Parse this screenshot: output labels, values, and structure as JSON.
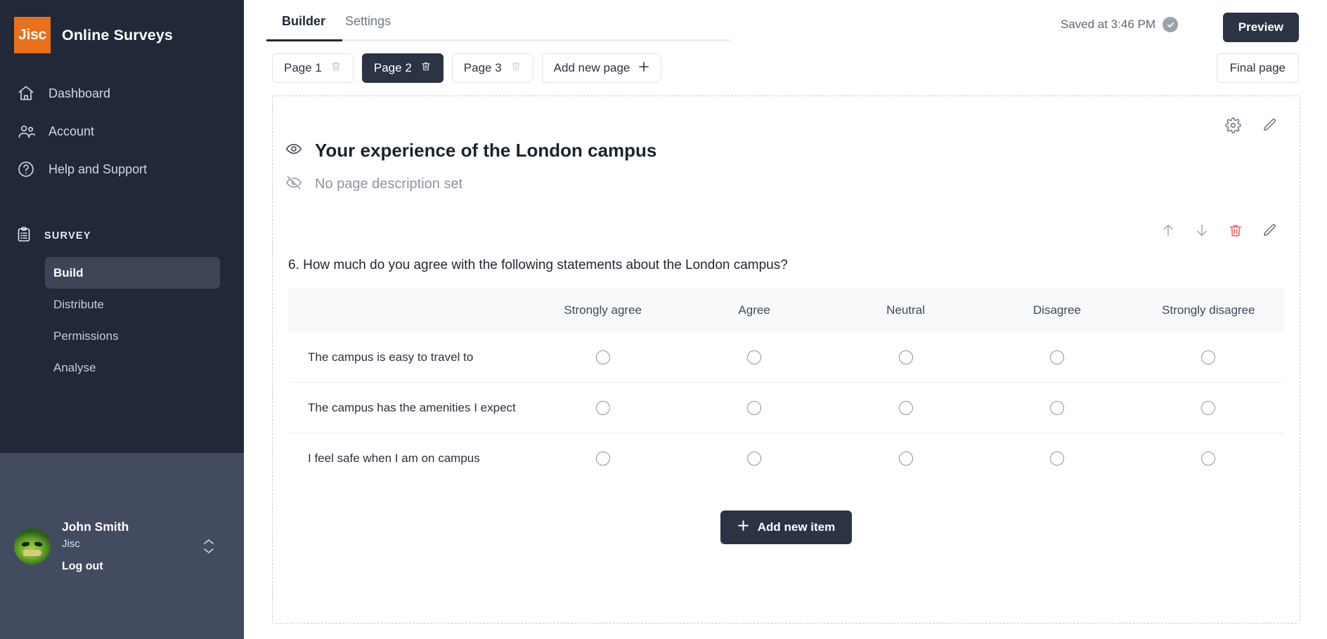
{
  "sidebar": {
    "brand": {
      "logo_text": "Jisc",
      "title": "Online Surveys"
    },
    "nav": [
      {
        "label": "Dashboard",
        "icon": "home-icon"
      },
      {
        "label": "Account",
        "icon": "users-icon"
      },
      {
        "label": "Help and Support",
        "icon": "question-circle-icon"
      }
    ],
    "survey_section": {
      "label": "SURVEY",
      "icon": "clipboard-icon"
    },
    "survey_items": [
      {
        "label": "Build",
        "active": true
      },
      {
        "label": "Distribute",
        "active": false
      },
      {
        "label": "Permissions",
        "active": false
      },
      {
        "label": "Analyse",
        "active": false
      }
    ],
    "user": {
      "name": "John Smith",
      "org": "Jisc",
      "logout_label": "Log out",
      "avatar_icon": "avatar"
    }
  },
  "topbar": {
    "tabs": [
      {
        "label": "Builder",
        "active": true
      },
      {
        "label": "Settings",
        "active": false
      }
    ],
    "saved_status": "Saved at 3:46 PM",
    "saved_icon": "check-circle-icon",
    "preview_label": "Preview"
  },
  "pagebar": {
    "pages": [
      {
        "label": "Page 1",
        "active": false
      },
      {
        "label": "Page 2",
        "active": true
      },
      {
        "label": "Page 3",
        "active": false
      }
    ],
    "add_page_label": "Add new page",
    "final_page_label": "Final page"
  },
  "card": {
    "page_title": "Your experience of the London campus",
    "page_title_icon": "eye-icon",
    "page_description": "No page description set",
    "page_description_icon": "eye-off-icon",
    "tools": [
      {
        "icon": "gear-icon"
      },
      {
        "icon": "pencil-icon"
      }
    ]
  },
  "question": {
    "text": "6. How much do you agree with the following statements about the London campus?",
    "tools": [
      {
        "icon": "arrow-up-icon"
      },
      {
        "icon": "arrow-down-icon"
      },
      {
        "icon": "trash-icon"
      },
      {
        "icon": "pencil-icon"
      }
    ],
    "columns": [
      "Strongly agree",
      "Agree",
      "Neutral",
      "Disagree",
      "Strongly disagree"
    ],
    "rows": [
      "The campus is easy to travel to",
      "The campus has the amenities I expect",
      "I feel safe when I am on campus"
    ]
  },
  "footer": {
    "add_item_label": "Add new item",
    "add_item_icon": "plus-icon"
  },
  "colors": {
    "sidebar_bg": "#212838",
    "brand_orange": "#e8701a",
    "accent_dark": "#2b3344",
    "danger_red": "#f26b6b"
  }
}
